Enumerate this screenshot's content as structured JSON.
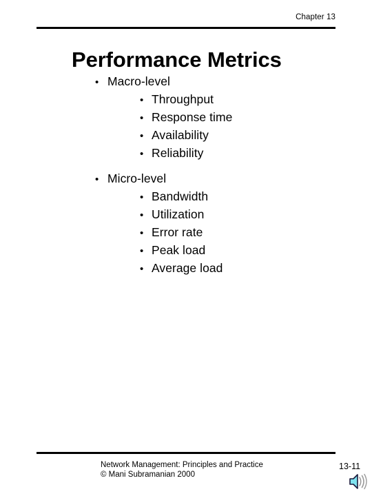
{
  "header": {
    "chapter_label": "Chapter 13"
  },
  "title": "Performance Metrics",
  "content": {
    "groups": [
      {
        "id": "macro",
        "heading": "Macro-level",
        "items": [
          "Throughput",
          "Response time",
          "Availability",
          "Reliability"
        ]
      },
      {
        "id": "micro",
        "heading": "Micro-level",
        "items": [
          "Bandwidth",
          "Utilization",
          "Error rate",
          "Peak load",
          "Average load"
        ]
      }
    ],
    "bullet_glyph": "•"
  },
  "footer": {
    "credit_line_1": "Network Management: Principles and Practice",
    "credit_line_2": "©  Mani Subramanian 2000",
    "page_number": "13-11",
    "sound_icon": "speaker-icon"
  },
  "colors": {
    "text": "#000000",
    "rule": "#000000",
    "background": "#ffffff",
    "speaker_body": "#7fe3ef",
    "speaker_outline": "#1a1a3c",
    "speaker_waves": "#9a9a9a"
  }
}
